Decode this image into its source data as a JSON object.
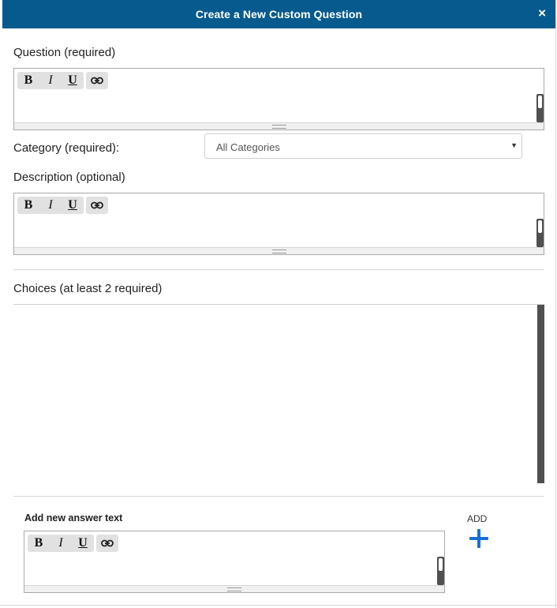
{
  "dialog": {
    "title": "Create a New Custom Question",
    "close_glyph": "×"
  },
  "question": {
    "label": "Question (required)",
    "toolbar": {
      "bold": "B",
      "italic": "I",
      "underline": "U",
      "link_icon": "link-icon"
    }
  },
  "category": {
    "label": "Category (required):",
    "selected": "All Categories",
    "arrow": "▼"
  },
  "description": {
    "label": "Description (optional)",
    "toolbar": {
      "bold": "B",
      "italic": "I",
      "underline": "U",
      "link_icon": "link-icon"
    }
  },
  "choices": {
    "label": "Choices (at least 2 required)"
  },
  "new_answer": {
    "label": "Add new answer text",
    "toolbar": {
      "bold": "B",
      "italic": "I",
      "underline": "U",
      "link_icon": "link-icon"
    },
    "add_label": "ADD",
    "add_icon": "plus-icon"
  },
  "colors": {
    "titlebar": "#065a8e",
    "add_plus": "#1a6fd6",
    "scrollbar": "#505050"
  }
}
